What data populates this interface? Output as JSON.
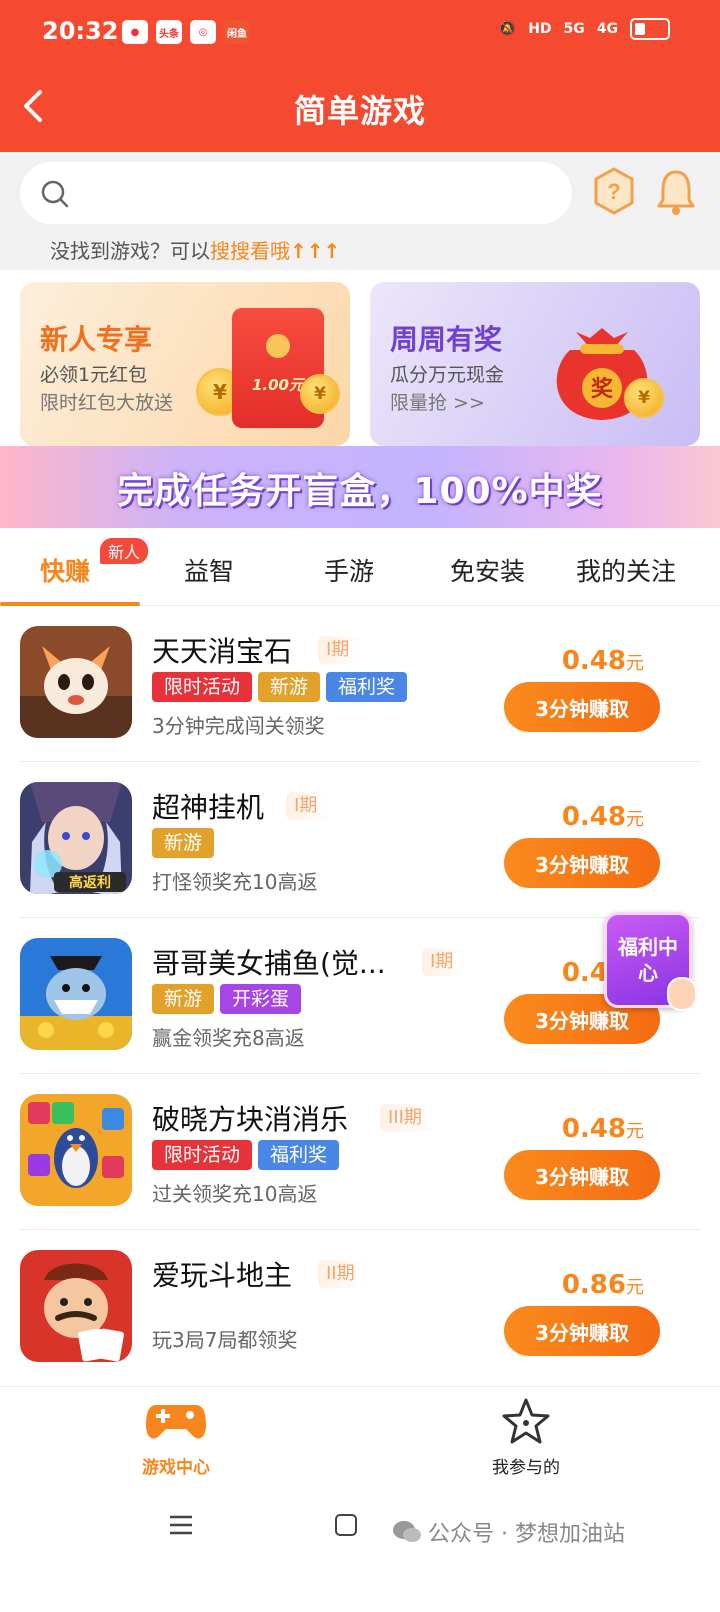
{
  "status_bar": {
    "time": "20:32",
    "app_icons": [
      "",
      "头条",
      "",
      "闲鱼"
    ],
    "indicators": [
      "HD",
      "5G",
      "4G"
    ]
  },
  "header": {
    "title": "简单游戏"
  },
  "search": {
    "placeholder": "",
    "not_found_prefix": "没找到游戏？可以",
    "not_found_link": "搜搜看哦",
    "not_found_arrows": "↑↑↑"
  },
  "promos": [
    {
      "title": "新人专享",
      "line1": "必领1元红包",
      "line2": "限时红包大放送",
      "packet_amount": "1.00元",
      "coin_symbol": "¥"
    },
    {
      "title": "周周有奖",
      "line1": "瓜分万元现金",
      "line2": "限量抢 >>",
      "bag_label": "奖",
      "coin_symbol": "¥"
    }
  ],
  "banner": {
    "text": "完成任务开盲盒，100%中奖"
  },
  "tabs": [
    {
      "label": "快赚",
      "active": true,
      "badge": "新人"
    },
    {
      "label": "益智"
    },
    {
      "label": "手游"
    },
    {
      "label": "免安装"
    },
    {
      "label": "我的关注"
    }
  ],
  "games": [
    {
      "name": "天天消宝石",
      "period": "I期",
      "tags": [
        {
          "text": "限时活动",
          "color": "#e8323a"
        },
        {
          "text": "新游",
          "color": "#e2a12a"
        },
        {
          "text": "福利奖",
          "color": "#4a86e6"
        }
      ],
      "desc": "3分钟完成闯关领奖",
      "price": "0.48",
      "unit": "元",
      "button": "3分钟赚取",
      "icon": "fox-game-icon"
    },
    {
      "name": "超神挂机",
      "period": "I期",
      "tags": [
        {
          "text": "新游",
          "color": "#e2a12a"
        }
      ],
      "desc": "打怪领奖充10高返",
      "price": "0.48",
      "unit": "元",
      "button": "3分钟赚取",
      "icon": "mage-game-icon",
      "icon_badge": "高返利"
    },
    {
      "name": "哥哥美女捕鱼(觉...",
      "period": "I期",
      "tags": [
        {
          "text": "新游",
          "color": "#e2a12a"
        },
        {
          "text": "开彩蛋",
          "color": "#a746e6"
        }
      ],
      "desc": "赢金领奖充8高返",
      "price": "0.48",
      "unit": "元",
      "button": "3分钟赚取",
      "icon": "shark-game-icon"
    },
    {
      "name": "破晓方块消消乐",
      "period": "III期",
      "tags": [
        {
          "text": "限时活动",
          "color": "#e8323a"
        },
        {
          "text": "福利奖",
          "color": "#4a86e6"
        }
      ],
      "desc": "过关领奖充10高返",
      "price": "0.48",
      "unit": "元",
      "button": "3分钟赚取",
      "icon": "penguin-game-icon"
    },
    {
      "name": "爱玩斗地主",
      "period": "II期",
      "tags": [],
      "desc": "玩3局7局都领奖",
      "price": "0.86",
      "unit": "元",
      "button": "3分钟赚取",
      "icon": "landlord-game-icon"
    }
  ],
  "floating": {
    "label": "福利中心"
  },
  "bottom_nav": [
    {
      "label": "游戏中心",
      "active": true
    },
    {
      "label": "我参与的",
      "active": false
    }
  ],
  "watermark": {
    "text": "公众号 · 梦想加油站"
  },
  "colors": {
    "brand": "#f64a30",
    "accent": "#f7871c"
  }
}
